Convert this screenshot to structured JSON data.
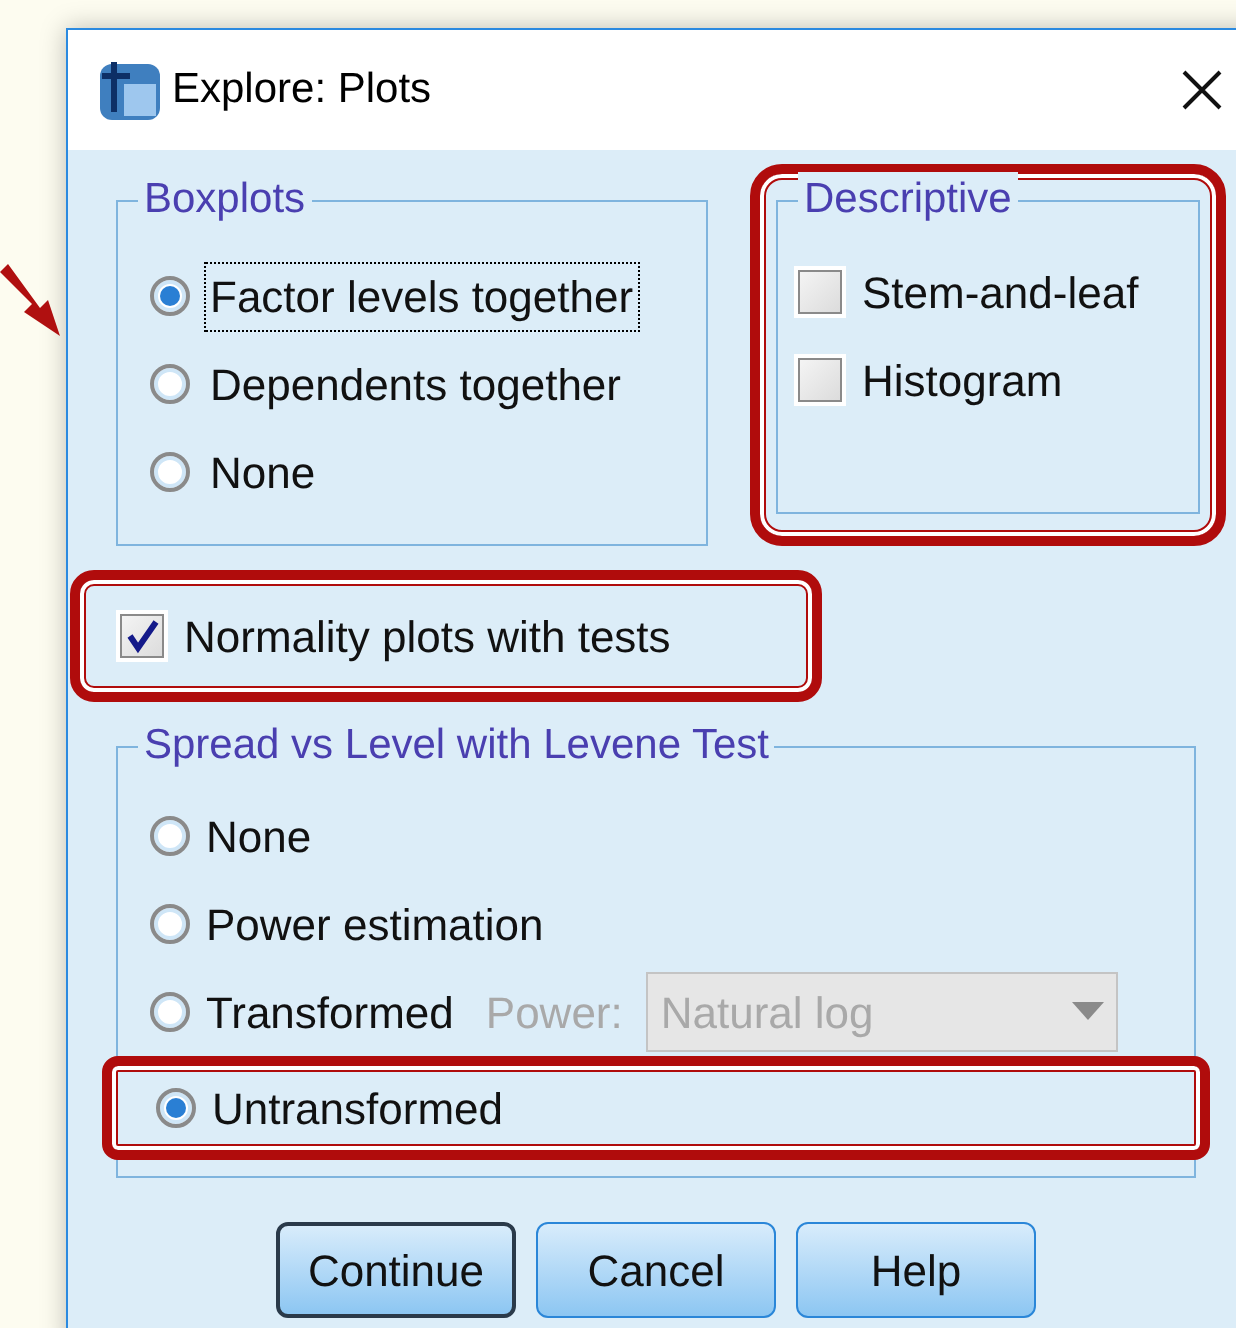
{
  "window": {
    "title": "Explore: Plots"
  },
  "boxplots": {
    "title": "Boxplots",
    "options": [
      {
        "label": "Factor levels together",
        "selected": true,
        "focused": true
      },
      {
        "label": "Dependents together",
        "selected": false,
        "focused": false
      },
      {
        "label": "None",
        "selected": false,
        "focused": false
      }
    ]
  },
  "descriptive": {
    "title": "Descriptive",
    "highlighted": true,
    "options": [
      {
        "label": "Stem-and-leaf",
        "checked": false
      },
      {
        "label": "Histogram",
        "checked": false
      }
    ]
  },
  "normality": {
    "label": "Normality plots with tests",
    "checked": true,
    "highlighted": true
  },
  "spread": {
    "title": "Spread vs Level with Levene Test",
    "options": [
      {
        "label": "None",
        "selected": false,
        "highlighted": false
      },
      {
        "label": "Power estimation",
        "selected": false,
        "highlighted": false
      },
      {
        "label": "Transformed",
        "selected": false,
        "highlighted": false,
        "power": {
          "label": "Power:",
          "value": "Natural log",
          "disabled": true
        }
      },
      {
        "label": "Untransformed",
        "selected": true,
        "highlighted": true
      }
    ]
  },
  "buttons": [
    {
      "label": "Continue",
      "default": true
    },
    {
      "label": "Cancel",
      "default": false
    },
    {
      "label": "Help",
      "default": false
    }
  ]
}
